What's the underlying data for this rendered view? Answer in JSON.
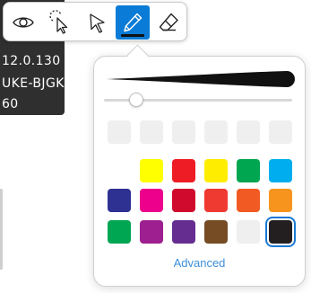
{
  "info_panel": {
    "lines": [
      "12.0.130",
      "UKE-BJGK",
      "60"
    ],
    "faded_line": ""
  },
  "toolbar": {
    "tools": [
      {
        "name": "view",
        "icon": "eye-icon",
        "active": false
      },
      {
        "name": "lasso-select",
        "icon": "lasso-select-icon",
        "active": false
      },
      {
        "name": "pointer",
        "icon": "pointer-arrow-icon",
        "active": false
      },
      {
        "name": "pen",
        "icon": "pen-icon",
        "active": true
      },
      {
        "name": "eraser",
        "icon": "eraser-icon",
        "active": false
      }
    ],
    "active_color": "#0a7bd6"
  },
  "pen_popover": {
    "stroke_color": "#111111",
    "stroke_width_level": 0.17,
    "recent_colors": [
      "",
      "",
      "",
      "",
      "",
      ""
    ],
    "palette": [
      [
        "",
        "#ffff00",
        "#ee1c24",
        "#ffed00",
        "#00a650",
        "#00aeef"
      ],
      [
        "#2e3192",
        "#ec008c",
        "#cf0a2c",
        "#ef3a32",
        "#f15a22",
        "#f7941d"
      ],
      [
        "#00a651",
        "#9e1f8f",
        "#662d91",
        "#754c24",
        "#efefef",
        "#231f20"
      ]
    ],
    "selected_color": "#231f20",
    "advanced_label": "Advanced"
  }
}
